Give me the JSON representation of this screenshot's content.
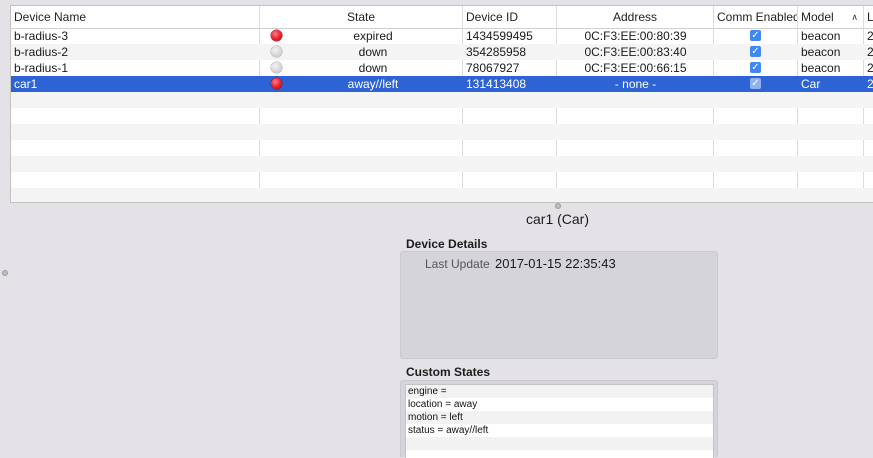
{
  "table": {
    "columns": [
      "Device Name",
      "State",
      "Device ID",
      "Address",
      "Comm Enabled",
      "Model",
      "La"
    ],
    "sort_icon": "chevron-up-icon",
    "rows": [
      {
        "name": "b-radius-3",
        "state_icon": "red",
        "state": "expired",
        "device_id": "1434599495",
        "address": "0C:F3:EE:00:80:39",
        "comm_enabled": true,
        "model": "beacon",
        "last": "2"
      },
      {
        "name": "b-radius-2",
        "state_icon": "gray",
        "state": "down",
        "device_id": "354285958",
        "address": "0C:F3:EE:00:83:40",
        "comm_enabled": true,
        "model": "beacon",
        "last": "2"
      },
      {
        "name": "b-radius-1",
        "state_icon": "gray",
        "state": "down",
        "device_id": "78067927",
        "address": "0C:F3:EE:00:66:15",
        "comm_enabled": true,
        "model": "beacon",
        "last": "2"
      },
      {
        "name": "car1",
        "state_icon": "red",
        "state": "away//left",
        "device_id": "131413408",
        "address": "- none -",
        "comm_enabled": true,
        "model": "Car",
        "last": "2"
      }
    ],
    "selected_row": 3
  },
  "detail_title": "car1 (Car)",
  "device_details": {
    "label": "Device Details",
    "last_update_label": "Last Update",
    "last_update_value": "2017-01-15 22:35:43"
  },
  "custom_states": {
    "label": "Custom States",
    "items": [
      "engine =",
      "location = away",
      "motion = left",
      "status = away//left"
    ]
  },
  "colors": {
    "selection": "#2e63d6",
    "state_red": "#e51d2c",
    "checkbox": "#3e87f5"
  }
}
